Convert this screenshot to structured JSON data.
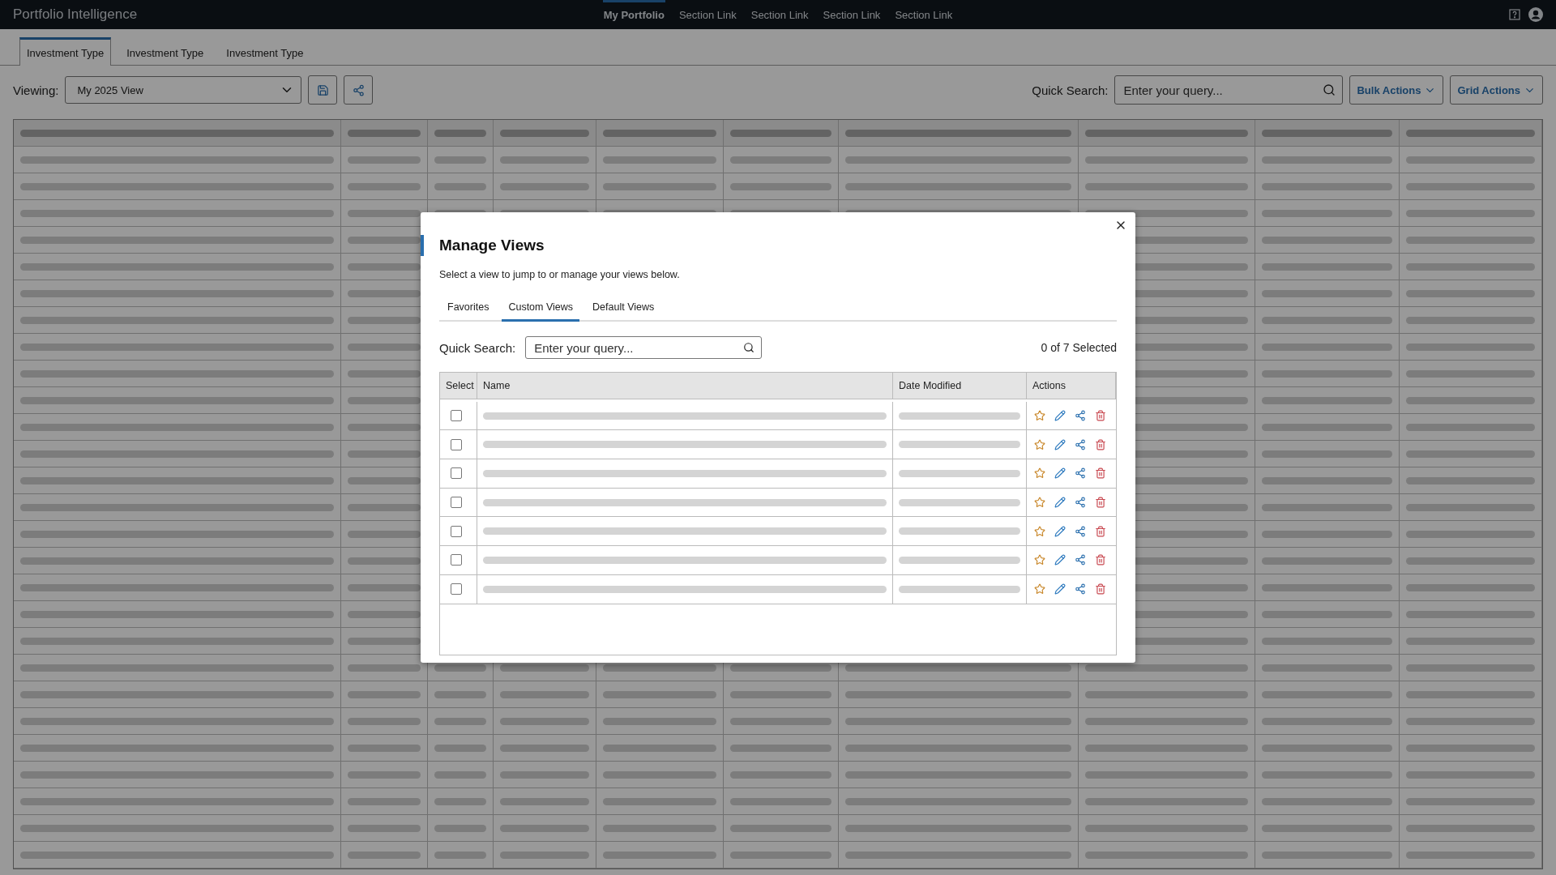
{
  "app": {
    "title": "Portfolio Intelligence",
    "nav": [
      {
        "label": "My Portfolio",
        "selected": true
      },
      {
        "label": "Section Link",
        "selected": false
      },
      {
        "label": "Section Link",
        "selected": false
      },
      {
        "label": "Section Link",
        "selected": false
      },
      {
        "label": "Section Link",
        "selected": false
      }
    ]
  },
  "page_tabs": [
    {
      "label": "Investment Type",
      "selected": true
    },
    {
      "label": "Investment Type",
      "selected": false
    },
    {
      "label": "Investment Type",
      "selected": false
    }
  ],
  "toolbar": {
    "viewing_label": "Viewing:",
    "view_select": "My 2025 View",
    "search_label": "Quick Search:",
    "search_placeholder": "Enter your query...",
    "buttons": [
      "Bulk Actions",
      "Grid Actions"
    ]
  },
  "modal": {
    "title": "Manage Views",
    "description": "Select a view to jump to or manage your views below.",
    "tabs": [
      {
        "label": "Favorites",
        "selected": false
      },
      {
        "label": "Custom Views",
        "selected": true
      },
      {
        "label": "Default Views",
        "selected": false
      }
    ],
    "search_label": "Quick Search:",
    "search_placeholder": "Enter your query...",
    "selection_count": "0 of 7 Selected",
    "columns": [
      "Select",
      "Name",
      "Date Modified",
      "Actions"
    ],
    "rows": [
      {
        "checked": false
      },
      {
        "checked": false
      },
      {
        "checked": false
      },
      {
        "checked": false
      },
      {
        "checked": false
      },
      {
        "checked": false
      },
      {
        "checked": false
      }
    ]
  }
}
